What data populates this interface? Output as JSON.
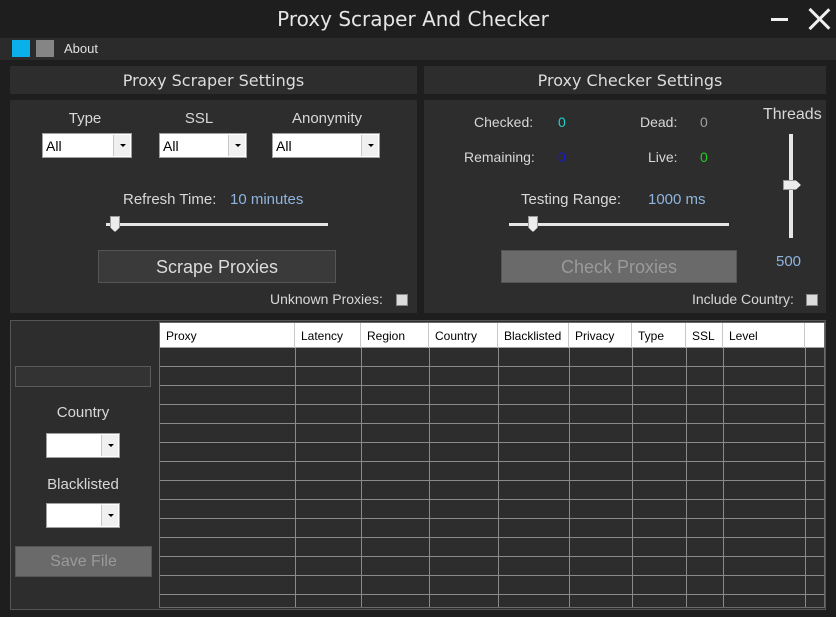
{
  "window": {
    "title": "Proxy Scraper And Checker"
  },
  "menu": {
    "about": "About"
  },
  "scraper": {
    "header": "Proxy Scraper Settings",
    "type_label": "Type",
    "type_value": "All",
    "ssl_label": "SSL",
    "ssl_value": "All",
    "anonymity_label": "Anonymity",
    "anonymity_value": "All",
    "refresh_label": "Refresh Time:",
    "refresh_value": "10 minutes",
    "scrape_button": "Scrape Proxies",
    "unknown_label": "Unknown Proxies:"
  },
  "checker": {
    "header": "Proxy Checker Settings",
    "checked_label": "Checked:",
    "checked_value": "0",
    "dead_label": "Dead:",
    "dead_value": "0",
    "remaining_label": "Remaining:",
    "remaining_value": "0",
    "live_label": "Live:",
    "live_value": "0",
    "threads_label": "Threads",
    "threads_value": "500",
    "range_label": "Testing Range:",
    "range_value": "1000 ms",
    "check_button": "Check Proxies",
    "country_label": "Include Country:"
  },
  "filter": {
    "country_label": "Country",
    "blacklisted_label": "Blacklisted",
    "save_button": "Save File"
  },
  "grid": {
    "columns": [
      "Proxy",
      "Latency",
      "Region",
      "Country",
      "Blacklisted",
      "Privacy",
      "Type",
      "SSL",
      "Level"
    ]
  },
  "colors": {
    "checked": "#1fd1d1",
    "dead": "#a0a0a0",
    "remaining": "#1a1ad0",
    "live": "#22cc22",
    "accent_blue": "#0ab0ea",
    "threads": "#8fb4de"
  }
}
